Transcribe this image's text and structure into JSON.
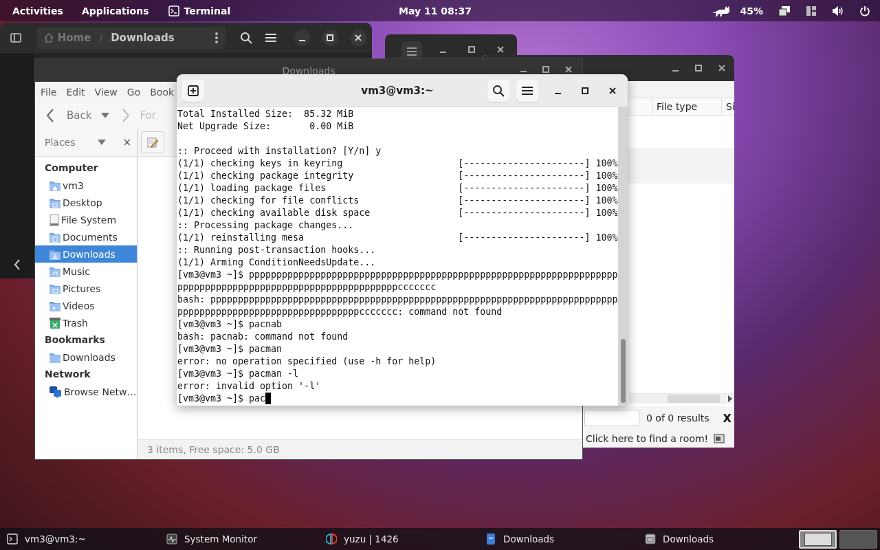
{
  "top_bar": {
    "activities": "Activities",
    "applications": "Applications",
    "app_menu": "Terminal",
    "clock": "May 11  08:37",
    "battery": "45%"
  },
  "dark_file_manager": {
    "path_separator": "/",
    "breadcrumb": [
      {
        "label": "Home",
        "selected": false
      },
      {
        "label": "Downloads",
        "selected": true
      }
    ]
  },
  "results_window": {
    "columns": [
      "File type",
      "Si"
    ],
    "search_status": "0 of 0 results",
    "close_label": "X",
    "footer": "Click here to find a room!"
  },
  "file_manager": {
    "title": "Downloads",
    "menu": [
      "File",
      "Edit",
      "View",
      "Go",
      "Book"
    ],
    "back": "Back",
    "forward": "For",
    "places": "Places",
    "places_close": "×",
    "sidebar": [
      {
        "heading": "Computer",
        "items": [
          {
            "label": "vm3",
            "kind": "home",
            "selected": false
          },
          {
            "label": "Desktop",
            "kind": "desktop",
            "selected": false
          },
          {
            "label": "File System",
            "kind": "drive",
            "selected": false
          },
          {
            "label": "Documents",
            "kind": "documents",
            "selected": false
          },
          {
            "label": "Downloads",
            "kind": "downloads",
            "selected": true
          },
          {
            "label": "Music",
            "kind": "music",
            "selected": false
          },
          {
            "label": "Pictures",
            "kind": "pictures",
            "selected": false
          },
          {
            "label": "Videos",
            "kind": "videos",
            "selected": false
          },
          {
            "label": "Trash",
            "kind": "trash",
            "selected": false
          }
        ]
      },
      {
        "heading": "Bookmarks",
        "items": [
          {
            "label": "Downloads",
            "kind": "folder",
            "selected": false
          }
        ]
      },
      {
        "heading": "Network",
        "items": [
          {
            "label": "Browse Netw…",
            "kind": "network",
            "selected": false
          }
        ]
      }
    ],
    "status": "3 items, Free space: 5.0 GB"
  },
  "terminal": {
    "title": "vm3@vm3:~",
    "lines": [
      {
        "kind": "output",
        "text": "Total Installed Size:  85.32 MiB"
      },
      {
        "kind": "output",
        "text": "Net Upgrade Size:       0.00 MiB"
      },
      {
        "kind": "blank"
      },
      {
        "kind": "output",
        "text": ":: Proceed with installation? [Y/n] y"
      },
      {
        "kind": "progress",
        "text": "(1/1) checking keys in keyring",
        "bar": "[----------------------]",
        "percent": "100%"
      },
      {
        "kind": "progress",
        "text": "(1/1) checking package integrity",
        "bar": "[----------------------]",
        "percent": "100%"
      },
      {
        "kind": "progress",
        "text": "(1/1) loading package files",
        "bar": "[----------------------]",
        "percent": "100%"
      },
      {
        "kind": "progress",
        "text": "(1/1) checking for file conflicts",
        "bar": "[----------------------]",
        "percent": "100%"
      },
      {
        "kind": "progress",
        "text": "(1/1) checking available disk space",
        "bar": "[----------------------]",
        "percent": "100%"
      },
      {
        "kind": "output",
        "text": ":: Processing package changes..."
      },
      {
        "kind": "progress",
        "text": "(1/1) reinstalling mesa",
        "bar": "[----------------------]",
        "percent": "100%"
      },
      {
        "kind": "output",
        "text": ":: Running post-transaction hooks..."
      },
      {
        "kind": "output",
        "text": "(1/1) Arming ConditionNeedsUpdate..."
      },
      {
        "kind": "output",
        "text": "[vm3@vm3 ~]$ ppppppppppppppppppppppppppppppppppppppppppppppppppppppppppppppppppp"
      },
      {
        "kind": "output",
        "text": "ppppppppppppppppppppppppppppppppppppppppccccccc"
      },
      {
        "kind": "output",
        "text": "bash: pppppppppppppppppppppppppppppppppppppppppppppppppppppppppppppppppppppppppp"
      },
      {
        "kind": "output",
        "text": "pppppppppppppppppppppppppppppppppccccccc: command not found"
      },
      {
        "kind": "output",
        "text": "[vm3@vm3 ~]$ pacnab"
      },
      {
        "kind": "output",
        "text": "bash: pacnab: command not found"
      },
      {
        "kind": "output",
        "text": "[vm3@vm3 ~]$ pacman"
      },
      {
        "kind": "output",
        "text": "error: no operation specified (use -h for help)"
      },
      {
        "kind": "output",
        "text": "[vm3@vm3 ~]$ pacman -l"
      },
      {
        "kind": "output",
        "text": "error: invalid option '-l'"
      },
      {
        "kind": "input",
        "text": "[vm3@vm3 ~]$ pac"
      }
    ]
  },
  "taskbar": {
    "items": [
      {
        "label": "vm3@vm3:~",
        "kind": "terminal"
      },
      {
        "label": "System Monitor",
        "kind": "monitor"
      },
      {
        "label": "yuzu | 1426",
        "kind": "game"
      },
      {
        "label": "Downloads",
        "kind": "files-blue"
      },
      {
        "label": "Downloads",
        "kind": "files-grey"
      }
    ],
    "workspaces": [
      {
        "selected": true
      },
      {
        "selected": false
      }
    ]
  }
}
